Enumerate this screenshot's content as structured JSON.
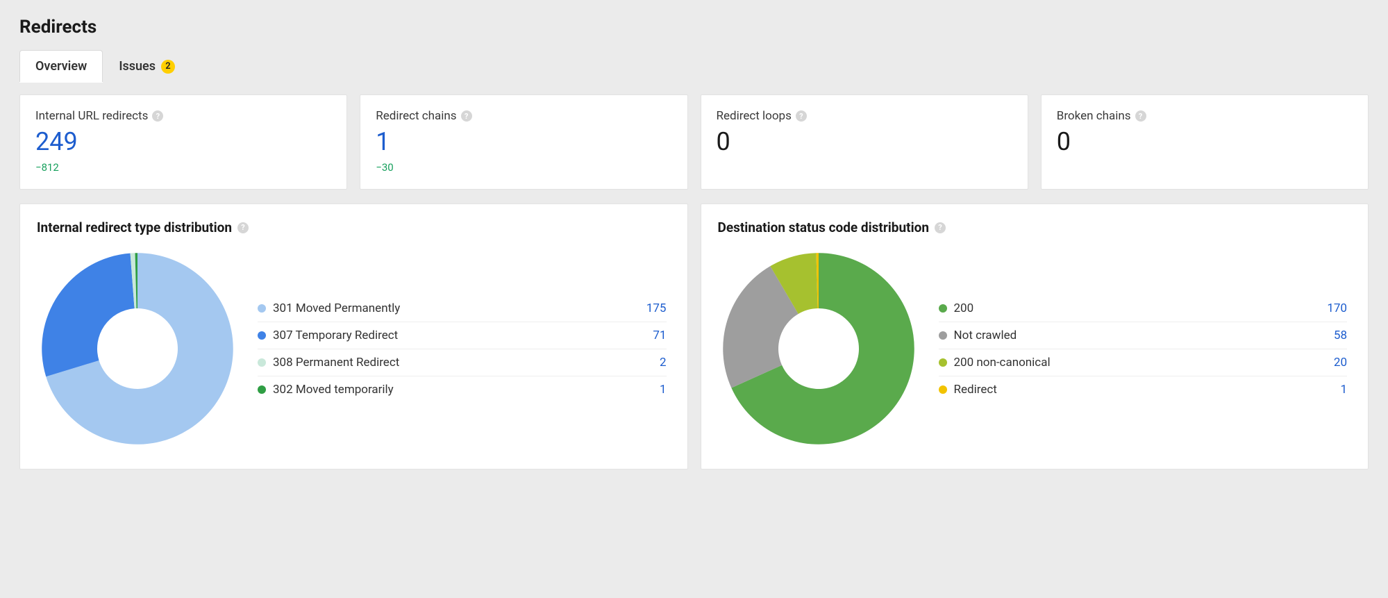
{
  "page_title": "Redirects",
  "tabs": [
    {
      "label": "Overview",
      "active": true
    },
    {
      "label": "Issues",
      "active": false,
      "badge": "2"
    }
  ],
  "cards": [
    {
      "title": "Internal URL redirects",
      "value": "249",
      "delta": "−812",
      "link": true
    },
    {
      "title": "Redirect chains",
      "value": "1",
      "delta": "−30",
      "link": true
    },
    {
      "title": "Redirect loops",
      "value": "0",
      "delta": "",
      "link": false
    },
    {
      "title": "Broken chains",
      "value": "0",
      "delta": "",
      "link": false
    }
  ],
  "charts": [
    {
      "title": "Internal redirect type distribution",
      "series": [
        {
          "label": "301 Moved Permanently",
          "value": 175,
          "color": "#a4c8f0"
        },
        {
          "label": "307 Temporary Redirect",
          "value": 71,
          "color": "#3f82e6"
        },
        {
          "label": "308 Permanent Redirect",
          "value": 2,
          "color": "#c9e8da"
        },
        {
          "label": "302 Moved temporarily",
          "value": 1,
          "color": "#2f9e44"
        }
      ]
    },
    {
      "title": "Destination status code distribution",
      "series": [
        {
          "label": "200",
          "value": 170,
          "color": "#5aaa4c"
        },
        {
          "label": "Not crawled",
          "value": 58,
          "color": "#9e9e9e"
        },
        {
          "label": "200 non-canonical",
          "value": 20,
          "color": "#a6c12f"
        },
        {
          "label": "Redirect",
          "value": 1,
          "color": "#f2c300"
        }
      ]
    }
  ],
  "chart_data": [
    {
      "type": "pie",
      "title": "Internal redirect type distribution",
      "categories": [
        "301 Moved Permanently",
        "307 Temporary Redirect",
        "308 Permanent Redirect",
        "302 Moved temporarily"
      ],
      "values": [
        175,
        71,
        2,
        1
      ]
    },
    {
      "type": "pie",
      "title": "Destination status code distribution",
      "categories": [
        "200",
        "Not crawled",
        "200 non-canonical",
        "Redirect"
      ],
      "values": [
        170,
        58,
        20,
        1
      ]
    }
  ],
  "help_glyph": "?"
}
